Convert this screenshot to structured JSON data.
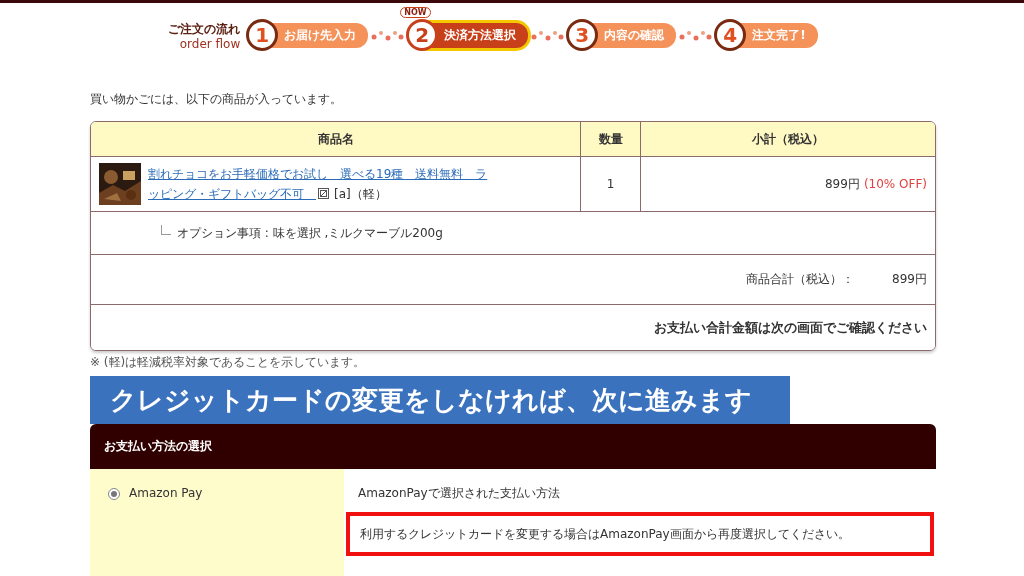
{
  "order_flow": {
    "title": "ご注文の流れ",
    "subtitle": "order flow",
    "steps": [
      {
        "number": "1",
        "label": "お届け先入力",
        "selected": false
      },
      {
        "number": "2",
        "label": "決済方法選択",
        "selected": true,
        "badge": "NOW"
      },
      {
        "number": "3",
        "label": "内容の確認",
        "selected": false
      },
      {
        "number": "4",
        "label": "注文完了!",
        "selected": false
      }
    ]
  },
  "intro": "買い物かごには、以下の商品が入っています。",
  "cart": {
    "columns": [
      "商品名",
      "数量",
      "小計（税込）"
    ],
    "items": [
      {
        "name_lines": [
          "割れチョコをお手軽価格でお試し　選べる19種　送料無料　ラ",
          "ッピング・ギフトバッグ不可　"
        ],
        "tags": "[a]（軽）",
        "quantity": "1",
        "price": "899円",
        "discount": "(10% OFF)",
        "option": "オプション事項 : 味を選択 ,ミルクマーブル200g"
      }
    ],
    "subtotal_label": "商品合計（税込）：",
    "subtotal": "899円",
    "total_note": "お支払い合計金額は次の画面でご確認ください"
  },
  "tax_note": "※ (軽)は軽減税率対象であることを示しています。",
  "banner": "クレジットカードの変更をしなければ、次に進みます",
  "payment": {
    "title": "お支払い方法の選択",
    "methods": [
      {
        "label": "Amazon Pay",
        "selected": true,
        "detail": "AmazonPayで選択された支払い方法",
        "note": "利用するクレジットカードを変更する場合はAmazonPay画面から再度選択してください。",
        "highlighted": true
      }
    ]
  }
}
